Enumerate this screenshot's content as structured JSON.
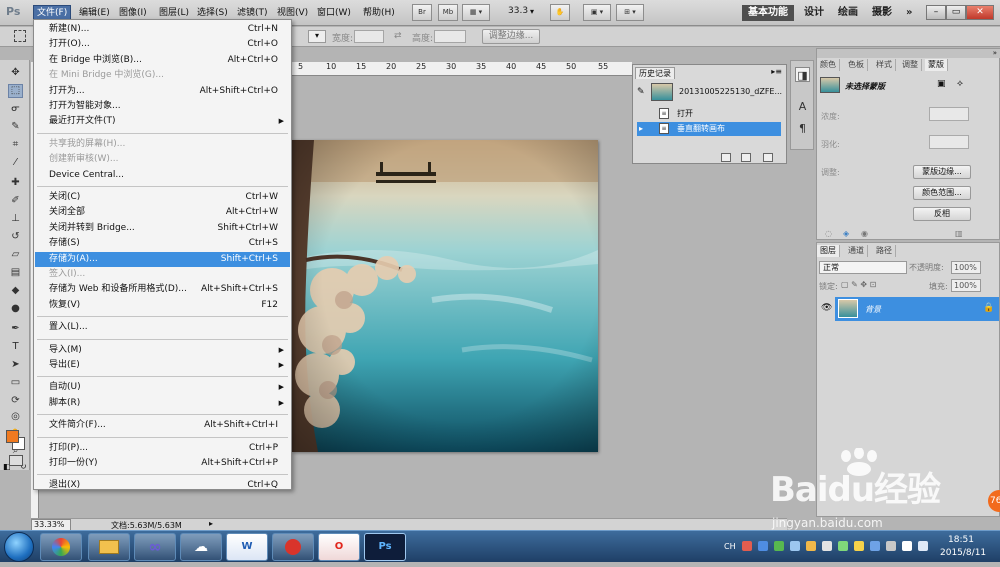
{
  "app": {
    "logo": "Ps"
  },
  "menubar": {
    "items": [
      "文件(F)",
      "编辑(E)",
      "图像(I)",
      "图层(L)",
      "选择(S)",
      "滤镜(T)",
      "视图(V)",
      "窗口(W)",
      "帮助(H)"
    ],
    "bridge_btn": "Br",
    "minibridge_btn": "Mb",
    "zoom": "33.3",
    "workspaces": [
      "基本功能",
      "设计",
      "绘画",
      "摄影",
      "»"
    ],
    "window_controls": [
      "–",
      "▭",
      "✕"
    ]
  },
  "options": {
    "width_label": "宽度:",
    "height_label": "高度:",
    "refine_edge": "调整边缘..."
  },
  "ruler": {
    "ticks": [
      "5",
      "10",
      "15",
      "20",
      "25",
      "30",
      "35",
      "40",
      "45",
      "50",
      "55"
    ]
  },
  "file_menu": {
    "items": [
      {
        "label": "新建(N)...",
        "shortcut": "Ctrl+N"
      },
      {
        "label": "打开(O)...",
        "shortcut": "Ctrl+O"
      },
      {
        "label": "在 Bridge 中浏览(B)...",
        "shortcut": "Alt+Ctrl+O"
      },
      {
        "label": "在 Mini Bridge 中浏览(G)...",
        "shortcut": "",
        "disabled": true
      },
      {
        "label": "打开为...",
        "shortcut": "Alt+Shift+Ctrl+O"
      },
      {
        "label": "打开为智能对象...",
        "shortcut": ""
      },
      {
        "label": "最近打开文件(T)",
        "shortcut": "",
        "submenu": true
      },
      {
        "sep": true
      },
      {
        "label": "共享我的屏幕(H)...",
        "shortcut": "",
        "disabled": true
      },
      {
        "label": "创建新审核(W)...",
        "shortcut": "",
        "disabled": true
      },
      {
        "label": "Device Central...",
        "shortcut": ""
      },
      {
        "sep": true
      },
      {
        "label": "关闭(C)",
        "shortcut": "Ctrl+W"
      },
      {
        "label": "关闭全部",
        "shortcut": "Alt+Ctrl+W"
      },
      {
        "label": "关闭并转到 Bridge...",
        "shortcut": "Shift+Ctrl+W"
      },
      {
        "label": "存储(S)",
        "shortcut": "Ctrl+S"
      },
      {
        "label": "存储为(A)...",
        "shortcut": "Shift+Ctrl+S",
        "highlighted": true
      },
      {
        "label": "签入(I)...",
        "shortcut": "",
        "disabled": true
      },
      {
        "label": "存储为 Web 和设备所用格式(D)...",
        "shortcut": "Alt+Shift+Ctrl+S"
      },
      {
        "label": "恢复(V)",
        "shortcut": "F12"
      },
      {
        "sep": true
      },
      {
        "label": "置入(L)...",
        "shortcut": ""
      },
      {
        "sep": true
      },
      {
        "label": "导入(M)",
        "shortcut": "",
        "submenu": true
      },
      {
        "label": "导出(E)",
        "shortcut": "",
        "submenu": true
      },
      {
        "sep": true
      },
      {
        "label": "自动(U)",
        "shortcut": "",
        "submenu": true
      },
      {
        "label": "脚本(R)",
        "shortcut": "",
        "submenu": true
      },
      {
        "sep": true
      },
      {
        "label": "文件简介(F)...",
        "shortcut": "Alt+Shift+Ctrl+I"
      },
      {
        "sep": true
      },
      {
        "label": "打印(P)...",
        "shortcut": "Ctrl+P"
      },
      {
        "label": "打印一份(Y)",
        "shortcut": "Alt+Shift+Ctrl+P"
      },
      {
        "sep": true
      },
      {
        "label": "退出(X)",
        "shortcut": "Ctrl+Q"
      }
    ]
  },
  "history": {
    "tab": "历史记录",
    "snapshot": "20131005225130_dZFE...",
    "states": [
      "打开",
      "垂直翻转画布"
    ]
  },
  "masks": {
    "tabs": [
      "颜色",
      "色板",
      "样式",
      "调整",
      "蒙版"
    ],
    "title": "未选择蒙版",
    "density_label": "浓度:",
    "feather_label": "羽化:",
    "refine_label": "调整:",
    "btn_edge": "蒙版边缘...",
    "btn_color_range": "颜色范围...",
    "btn_invert": "反相"
  },
  "layers": {
    "tabs": [
      "图层",
      "通道",
      "路径"
    ],
    "blend_mode": "正常",
    "opacity_label": "不透明度:",
    "opacity": "100%",
    "lock_label": "锁定:",
    "fill_label": "填充:",
    "fill": "100%",
    "layer_name": "背景"
  },
  "status": {
    "zoom": "33.33%",
    "doc_size": "文档:5.63M/5.63M"
  },
  "watermark": {
    "brand": "Baidu经验",
    "url": "jingyan.baidu.com",
    "badge": "76"
  },
  "taskbar": {
    "apps": [
      "",
      "",
      "",
      "",
      "W",
      "",
      "O",
      "Ps"
    ],
    "lang": "CH",
    "time": "18:51",
    "date": "2015/8/11"
  },
  "colors": {
    "foreground": "#f07a20",
    "background": "#ffffff",
    "highlight": "#3d8fe0"
  }
}
